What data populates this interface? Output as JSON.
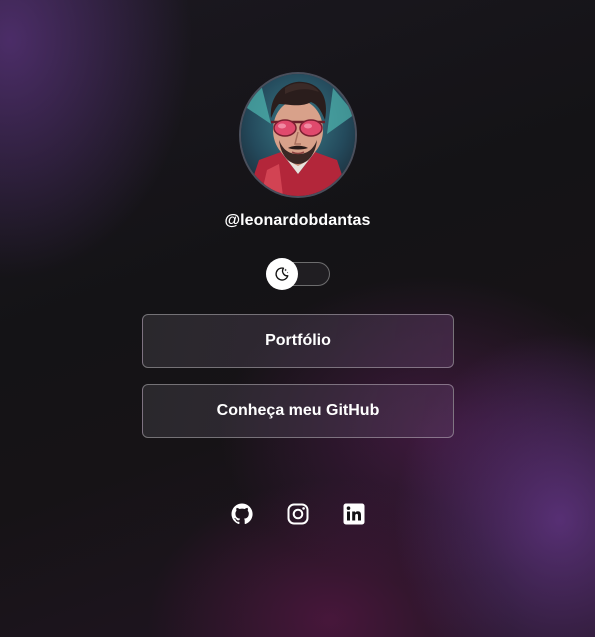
{
  "profile": {
    "username": "@leonardobdantas",
    "avatar_icon": "profile-illustration"
  },
  "theme_toggle": {
    "icon": "moon-icon",
    "state": "off"
  },
  "links": [
    {
      "label": "Portfólio"
    },
    {
      "label": "Conheça meu GitHub"
    }
  ],
  "social": [
    {
      "icon": "github-icon"
    },
    {
      "icon": "instagram-icon"
    },
    {
      "icon": "linkedin-icon"
    }
  ],
  "colors": {
    "text": "#ffffff",
    "background_dark": "#141316",
    "accent_purple": "#5c3480"
  }
}
